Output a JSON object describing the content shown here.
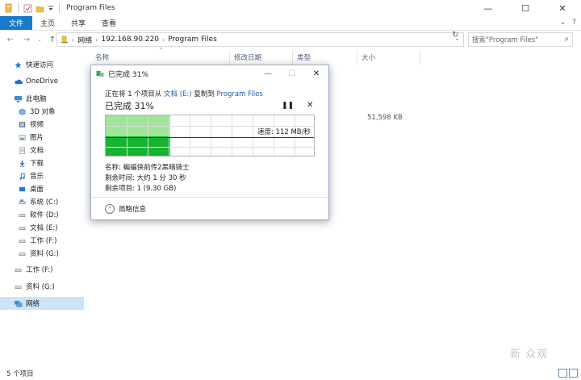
{
  "window": {
    "title": "Program Files",
    "controls": [
      "—",
      "☐",
      "✕"
    ]
  },
  "ribbon": {
    "tabs": [
      "文件",
      "主页",
      "共享",
      "查看"
    ]
  },
  "address": {
    "crumbs": [
      "网络",
      "192.168.90.220",
      "Program Files"
    ],
    "search_placeholder": "搜索\"Program Files\""
  },
  "sidebar": {
    "items": [
      {
        "label": "快速访问",
        "icon": "star-icon"
      },
      {
        "label": "OneDrive",
        "icon": "cloud-icon"
      },
      {
        "label": "此电脑",
        "icon": "pc-icon"
      },
      {
        "label": "3D 对象",
        "icon": "cube-icon"
      },
      {
        "label": "视频",
        "icon": "video-icon"
      },
      {
        "label": "图片",
        "icon": "picture-icon"
      },
      {
        "label": "文档",
        "icon": "document-icon"
      },
      {
        "label": "下载",
        "icon": "download-icon"
      },
      {
        "label": "音乐",
        "icon": "music-icon"
      },
      {
        "label": "桌面",
        "icon": "desktop-icon"
      },
      {
        "label": "系统 (C:)",
        "icon": "drive-icon"
      },
      {
        "label": "软件 (D:)",
        "icon": "drive-icon"
      },
      {
        "label": "文档 (E:)",
        "icon": "drive-icon"
      },
      {
        "label": "工作 (F:)",
        "icon": "drive-icon"
      },
      {
        "label": "资料 (G:)",
        "icon": "drive-icon"
      },
      {
        "label": "工作 (F:)",
        "icon": "drive-icon"
      },
      {
        "label": "资料 (G:)",
        "icon": "drive-icon"
      },
      {
        "label": "网络",
        "icon": "network-icon"
      }
    ]
  },
  "columns": {
    "name": "名称",
    "modified": "修改日期",
    "type": "类型",
    "size": "大小"
  },
  "file_size": "51,598 KB",
  "status": {
    "count": "5 个项目"
  },
  "dialog": {
    "title": "已完成 31%",
    "copy_prefix": "正在将 1 个项目从",
    "source": "文档 (E:)",
    "copy_mid": "复制到",
    "destination": "Program Files",
    "percent_label": "已完成 31%",
    "progress": 0.31,
    "speed": "速度: 112 MB/秒",
    "name_line": "名称: 蝙蝠侠前传2黑暗骑士",
    "time_line": "剩余时间: 大约 1 分 30 秒",
    "items_line": "剩余项目: 1 (9.30 GB)",
    "less_info": "简略信息"
  },
  "watermark": "新 众观"
}
